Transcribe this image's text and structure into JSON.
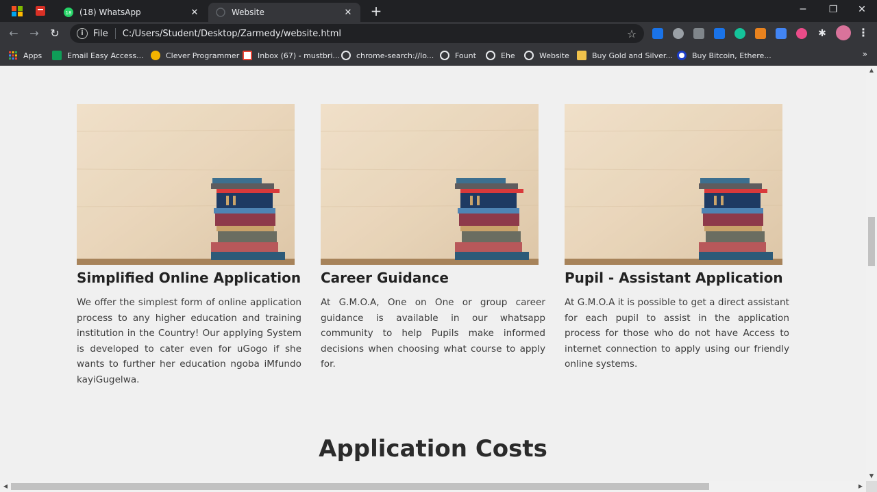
{
  "browser": {
    "tabs": [
      {
        "title": "(18) WhatsApp",
        "close": "✕"
      },
      {
        "title": "Website",
        "close": "✕"
      }
    ],
    "new_tab": "+",
    "window_controls": {
      "minimize": "─",
      "restore": "❐",
      "close": "✕"
    },
    "address": {
      "scheme": "File",
      "url": "C:/Users/Student/Desktop/Zarmedy/website.html"
    },
    "bookmarks": [
      "Apps",
      "Email Easy Access...",
      "Clever Programmer",
      "Inbox (67) - mustbri...",
      "chrome-search://lo...",
      "Fount",
      "Ehe",
      "Website",
      "Buy Gold and Silver...",
      "Buy Bitcoin, Ethere..."
    ]
  },
  "page": {
    "cards": [
      {
        "title": "Simplified Online Application",
        "text": "We offer the simplest form of online application process to any higher education and training institution in the Country! Our applying System is developed to cater even for uGogo if she wants to further her education ngoba iMfundo kayiGugelwa."
      },
      {
        "title": "Career Guidance",
        "text": "At G.M.O.A, One on One or group career guidance is available in our whatsapp community to help Pupils make informed decisions when choosing what course to apply for."
      },
      {
        "title": "Pupil - Assistant Application",
        "text": "At G.M.O.A it is possible to get a direct assistant for each pupil to assist in the application process for those who do not have Access to internet connection to apply using our friendly online systems."
      }
    ],
    "section_title": "Application Costs"
  },
  "colors": {
    "tabstrip": "#202124",
    "toolbar": "#35363a",
    "page_background": "#f0f0f0",
    "whatsapp_green": "#25d366"
  }
}
